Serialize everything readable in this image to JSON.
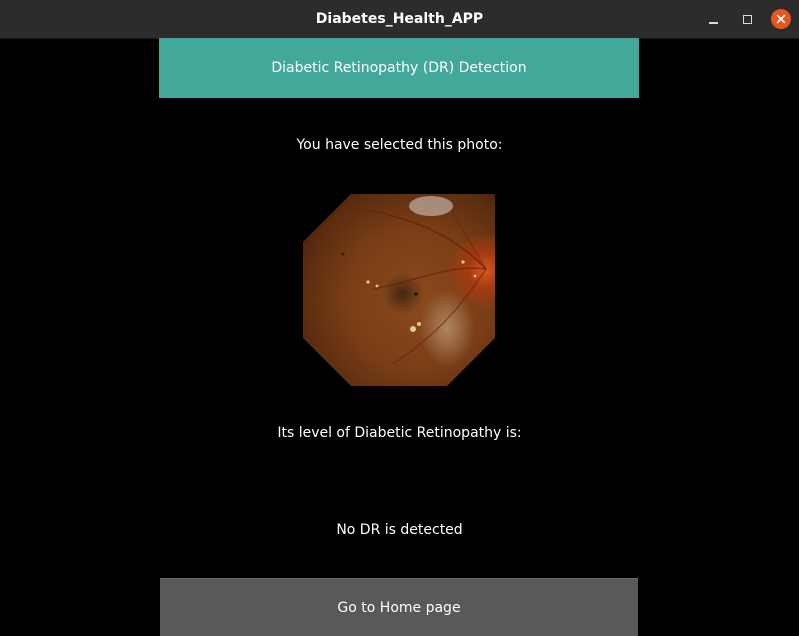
{
  "window": {
    "title": "Diabetes_Health_APP",
    "controls": [
      "minimize-icon",
      "maximize-icon",
      "close-icon"
    ],
    "close_color": "#e9541f"
  },
  "header": {
    "label": "Diabetic Retinopathy (DR) Detection",
    "color": "#42a99a"
  },
  "main": {
    "selected_text": "You have selected this photo:",
    "level_label": "Its level of Diabetic Retinopathy is:",
    "result": "No DR is detected"
  },
  "footer": {
    "home_button": "Go to Home page",
    "color": "#595959"
  }
}
